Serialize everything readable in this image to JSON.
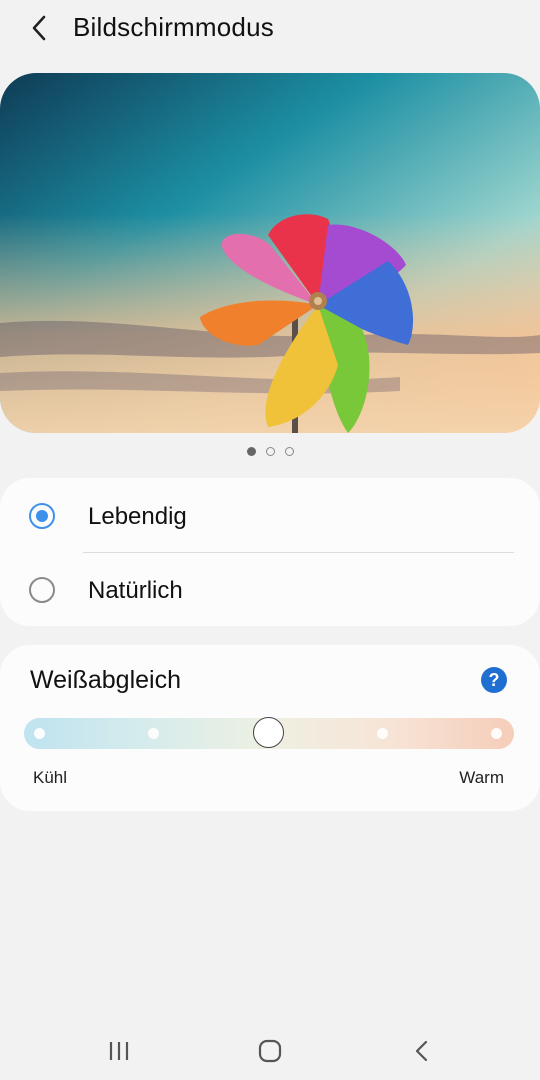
{
  "header": {
    "title": "Bildschirmmodus",
    "back_icon": "chevron-left-icon"
  },
  "hero": {
    "image": "pinwheel-photo",
    "page_count": 3,
    "current_page": 1
  },
  "modes": {
    "options": [
      {
        "label": "Lebendig",
        "selected": true
      },
      {
        "label": "Natürlich",
        "selected": false
      }
    ],
    "accent": "#3e91ea"
  },
  "white_balance": {
    "title": "Weißabgleich",
    "help_icon": "question-circle-icon",
    "min_label": "Kühl",
    "max_label": "Warm",
    "steps": 5,
    "value_step": 3
  },
  "navbar": {
    "recents_icon": "recents-icon",
    "home_icon": "home-icon",
    "back_icon": "back-icon"
  }
}
